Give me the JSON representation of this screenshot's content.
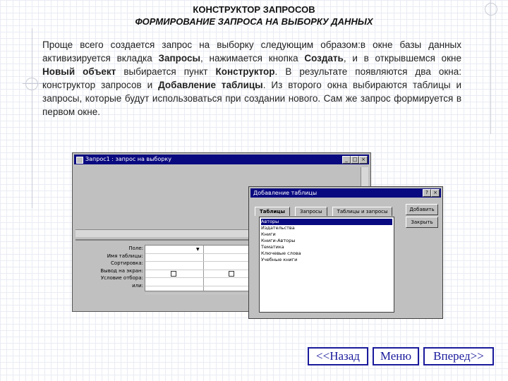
{
  "header": {
    "title": "КОНСТРУКТОР ЗАПРОСОВ",
    "subtitle": "ФОРМИРОВАНИЕ ЗАПРОСА НА ВЫБОРКУ ДАННЫХ"
  },
  "paragraph": {
    "p1": "Проще всего создается запрос на выборку следующим образом:в окне базы данных активизируется вкладка ",
    "b1": "Запросы",
    "p2": ", нажимается кнопка ",
    "b2": "Создать",
    "p3": ", и в открывшемся окне ",
    "b3": "Новый объект",
    "p4": " выбирается пункт ",
    "b4": "Конструктор",
    "p5": ". В результате появляются два окна: конструктор запросов и ",
    "b5": "Добавление таблицы",
    "p6": ". Из второго окна выбираются таблицы и запросы, которые будут использоваться при создании нового. Сам же запрос формируется в первом окне."
  },
  "screenshot": {
    "window_title": "Запрос1 : запрос на выборку",
    "grid_labels": [
      "Поле:",
      "Имя таблицы:",
      "Сортировка:",
      "Вывод на экран:",
      "Условие отбора:",
      "или:"
    ],
    "dialog": {
      "title": "Добавление таблицы",
      "tabs": [
        "Таблицы",
        "Запросы",
        "Таблицы и запросы"
      ],
      "items": [
        "Авторы",
        "Издательства",
        "Книги",
        "Книги-Авторы",
        "Тематика",
        "Ключевые слова",
        "Учебные книги"
      ],
      "add_button": "Добавить",
      "close_button": "Закрыть"
    }
  },
  "nav": {
    "back": "<<Назад",
    "menu": "Меню",
    "forward": "Вперед>>"
  },
  "colors": {
    "nav_border": "#1a1a9c",
    "titlebar": "#0a0a80"
  }
}
